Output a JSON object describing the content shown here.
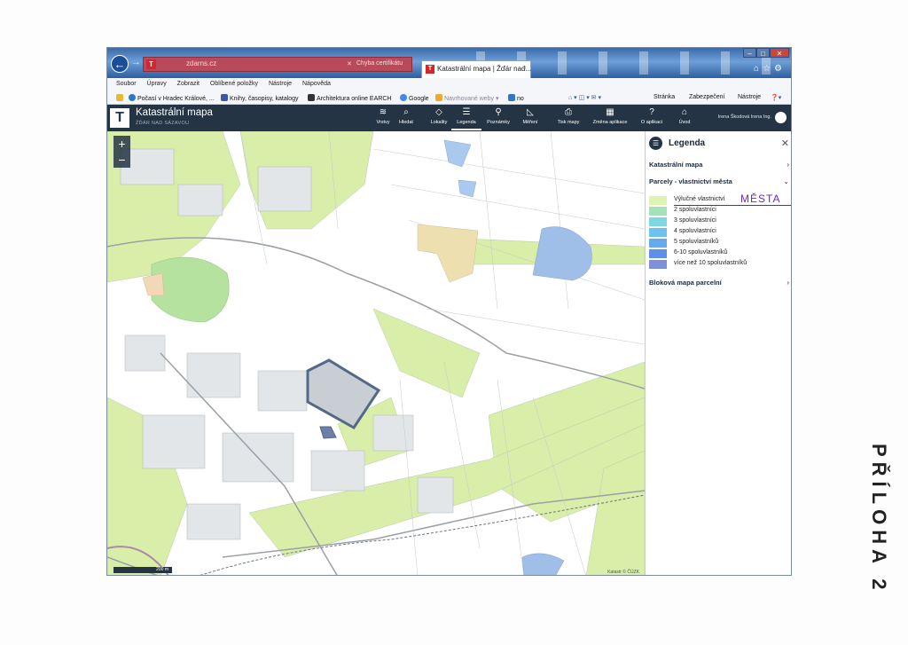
{
  "browser": {
    "address_url": "zdarns.cz",
    "certificate_error": "Chyba certifikátu",
    "tab_title": "Katastrální mapa | Žďár nad...",
    "menu": [
      "Soubor",
      "Úpravy",
      "Zobrazit",
      "Oblíbené položky",
      "Nástroje",
      "Nápověda"
    ],
    "favorites": [
      "Počasí v Hradec Králové, ...",
      "Knihy, časopisy, katalogy",
      "Architektura online EARCH",
      "Google",
      "Navrhované weby",
      "no"
    ],
    "command_bar": [
      "Stránka",
      "Zabezpečení",
      "Nástroje"
    ]
  },
  "app": {
    "title": "Katastrální mapa",
    "subtitle": "ŽĎÁR NAD SÁZAVOU",
    "tools": [
      {
        "label": "Vrstvy",
        "icon": "layers-icon",
        "glyph": "≋"
      },
      {
        "label": "Hledat",
        "icon": "search-icon",
        "glyph": "⌕"
      },
      {
        "label": "Lokality",
        "icon": "polygon-icon",
        "glyph": "◇"
      },
      {
        "label": "Legenda",
        "icon": "list-icon",
        "glyph": "☰"
      },
      {
        "label": "Poznámky",
        "icon": "pin-icon",
        "glyph": "⚲"
      },
      {
        "label": "Měření",
        "icon": "ruler-icon",
        "glyph": "◺"
      },
      {
        "label": "Tisk mapy",
        "icon": "printer-icon",
        "glyph": "⎙"
      },
      {
        "label": "Změna aplikace",
        "icon": "grid-icon",
        "glyph": "▦"
      },
      {
        "label": "O aplikaci",
        "icon": "info-icon",
        "glyph": "?"
      },
      {
        "label": "Úvod",
        "icon": "home-icon",
        "glyph": "⌂"
      }
    ],
    "user": "Irena Škodová Irena Ing."
  },
  "map": {
    "scale_label": "200 m",
    "attribution": "Katastr © ČÚZK"
  },
  "legend": {
    "title": "Legenda",
    "sections": {
      "cadastral": "Katastrální mapa",
      "ownership": "Parcely - vlastnictví města",
      "block_map": "Bloková mapa parcelní"
    },
    "items": [
      {
        "label": "Výlučné vlastnictví",
        "color": "#dff3b2"
      },
      {
        "label": "2 spoluvlastníci",
        "color": "#a4e3b8"
      },
      {
        "label": "3 spoluvlastníci",
        "color": "#7fd7e6"
      },
      {
        "label": "4 spoluvlastníci",
        "color": "#6cc3ef"
      },
      {
        "label": "5 spoluvlastníků",
        "color": "#65a9ee"
      },
      {
        "label": "6-10 spoluvlastníků",
        "color": "#5f8fe8"
      },
      {
        "label": "více než 10 spoluvlastníků",
        "color": "#7f8fd8"
      }
    ],
    "handwritten_note": "MĚSTA"
  },
  "side_note": "PŘÍLOHA 2"
}
